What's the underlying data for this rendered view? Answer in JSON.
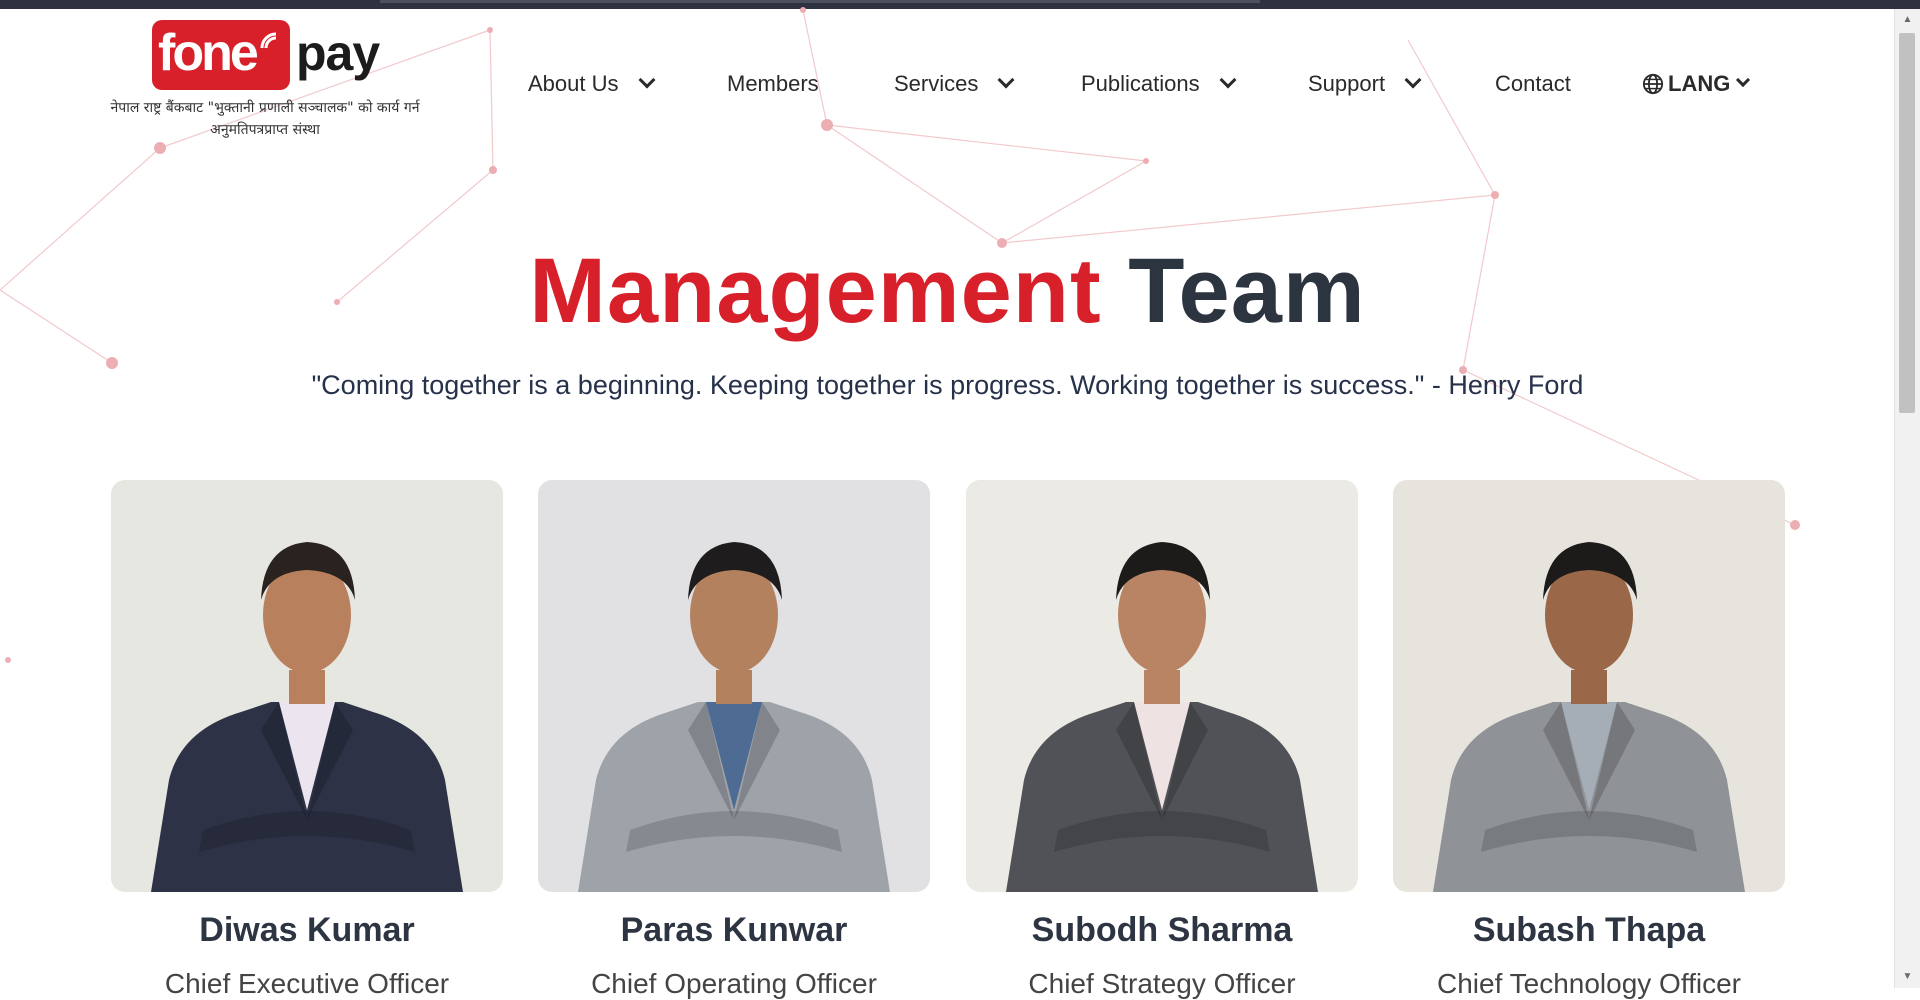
{
  "brand": {
    "logo_fone": "fone",
    "logo_pay": "pay",
    "tagline": "नेपाल राष्ट्र बैंकबाट \"भुक्तानी प्रणाली सञ्चालक\" को कार्य गर्न अनुमतिपत्रप्राप्त संस्था",
    "red": "#d8202b",
    "dark": "#2c3440"
  },
  "nav": {
    "items": [
      {
        "label": "About Us",
        "dropdown": true
      },
      {
        "label": "Members",
        "dropdown": false
      },
      {
        "label": "Services",
        "dropdown": true
      },
      {
        "label": "Publications",
        "dropdown": true
      },
      {
        "label": "Support",
        "dropdown": true
      },
      {
        "label": "Contact",
        "dropdown": false
      }
    ],
    "lang": {
      "label": "LANG",
      "icon": "globe-icon"
    }
  },
  "hero": {
    "title_red": "Management",
    "title_dark": "Team",
    "quote": "\"Coming together is a beginning. Keeping together is progress. Working together is success.\" - Henry Ford"
  },
  "team": [
    {
      "name": "Diwas Kumar",
      "role": "Chief Executive Officer",
      "bg": "#e6e7e0",
      "suit": "#2d3246",
      "shirt": "#ece4ef",
      "skin": "#b9805e",
      "hair": "#2a221f"
    },
    {
      "name": "Paras Kunwar",
      "role": "Chief Operating Officer",
      "bg": "#e1e1e3",
      "suit": "#9ea3aa",
      "shirt": "#4e6b93",
      "skin": "#b4815f",
      "hair": "#1f1c1d"
    },
    {
      "name": "Subodh Sharma",
      "role": "Chief Strategy Officer",
      "bg": "#eceae4",
      "suit": "#505257",
      "shirt": "#eee2e2",
      "skin": "#b98463",
      "hair": "#1d1a1a"
    },
    {
      "name": "Subash Thapa",
      "role": "Chief Technology Officer",
      "bg": "#e6e4dd",
      "suit": "#8f9296",
      "shirt": "#a5adb7",
      "skin": "#9a6848",
      "hair": "#1d1a1a"
    }
  ]
}
